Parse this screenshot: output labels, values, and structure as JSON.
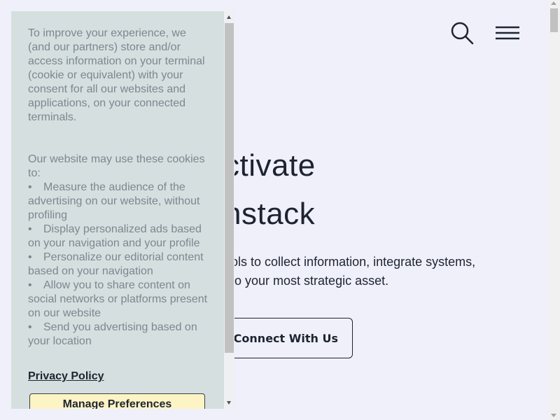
{
  "header": {
    "search_icon": "search-icon",
    "menu_icon": "hamburger-menu-icon"
  },
  "hero": {
    "line1": "ctivate",
    "line2": "nstack",
    "description": "ools to collect information, integrate systems, nto your most strategic asset.",
    "desc_line1": "ools to collect information, integrate systems,",
    "desc_line2": "nto your most strategic asset.",
    "cta_label": "Connect With Us"
  },
  "cookie_panel": {
    "intro": "To improve your experience, we (and our partners) store and/or access information on your terminal (cookie or equivalent) with your consent for all our websites and applications, on your connected terminals.",
    "uses_intro": "Our website may use these cookies to:",
    "uses": [
      "Measure the audience of the advertising on our website, without profiling",
      "Display personalized ads based on your navigation and your profile",
      "Personalize our editorial content based on your navigation",
      "Allow you to share content on social networks or platforms present on our website",
      "Send you advertising based on your location"
    ],
    "privacy_link": "Privacy Policy",
    "manage_button": "Manage Preferences"
  },
  "colors": {
    "page_background": "#eff0fa",
    "panel_background": "#d5dfdf",
    "panel_text": "#7c8791",
    "primary_text": "#1d2430",
    "manage_button_bg": "#fdf4c5"
  }
}
